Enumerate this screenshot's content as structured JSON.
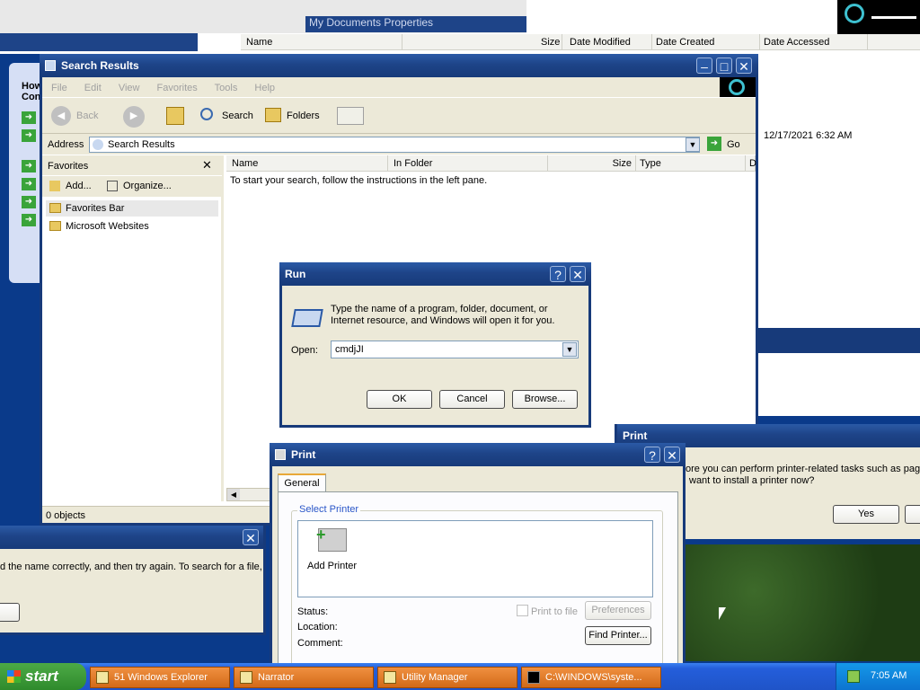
{
  "bg_details": {
    "title": "My Documents Properties",
    "columns": [
      "Name",
      "Size",
      "Date Modified",
      "Date Created",
      "Date Accessed"
    ],
    "accessed_value": "12/17/2021 6:32 AM"
  },
  "left_panel": {
    "title_partial_1": "How",
    "title_partial_2": "Con"
  },
  "search_window": {
    "title": "Search Results",
    "menu": [
      "File",
      "Edit",
      "View",
      "Favorites",
      "Tools",
      "Help"
    ],
    "toolbar": {
      "back": "Back",
      "search": "Search",
      "folders": "Folders"
    },
    "address_label": "Address",
    "address_value": "Search Results",
    "go_label": "Go",
    "favorites": {
      "title": "Favorites",
      "add": "Add...",
      "organize": "Organize...",
      "items": [
        "Favorites Bar",
        "Microsoft Websites"
      ]
    },
    "columns": [
      "Name",
      "In Folder",
      "Size",
      "Type",
      "D"
    ],
    "empty_message": "To start your search, follow the instructions in the left pane.",
    "status": "0 objects"
  },
  "run_dialog": {
    "title": "Run",
    "help": "?",
    "description": "Type the name of a program, folder, document, or Internet resource, and Windows will open it for you.",
    "open_label": "Open:",
    "open_value": "cmdjJI",
    "ok": "OK",
    "cancel": "Cancel",
    "browse": "Browse..."
  },
  "error_dialog": {
    "message": "d the name correctly, and then try again. To search for a file,"
  },
  "print_prompt": {
    "title": "Print",
    "line1": "ore you can perform printer-related tasks such as page s",
    "line2": "want to install a printer now?",
    "yes": "Yes"
  },
  "print_dialog": {
    "title": "Print",
    "help": "?",
    "tab": "General",
    "group": "Select Printer",
    "add_printer": "Add Printer",
    "status_label": "Status:",
    "location_label": "Location:",
    "comment_label": "Comment:",
    "print_to_file": "Print to file",
    "preferences": "Preferences",
    "find_printer": "Find Printer..."
  },
  "taskbar": {
    "start": "start",
    "tasks": [
      "51 Windows Explorer",
      "Narrator",
      "Utility Manager",
      "C:\\WINDOWS\\syste..."
    ],
    "clock": "7:05 AM"
  }
}
